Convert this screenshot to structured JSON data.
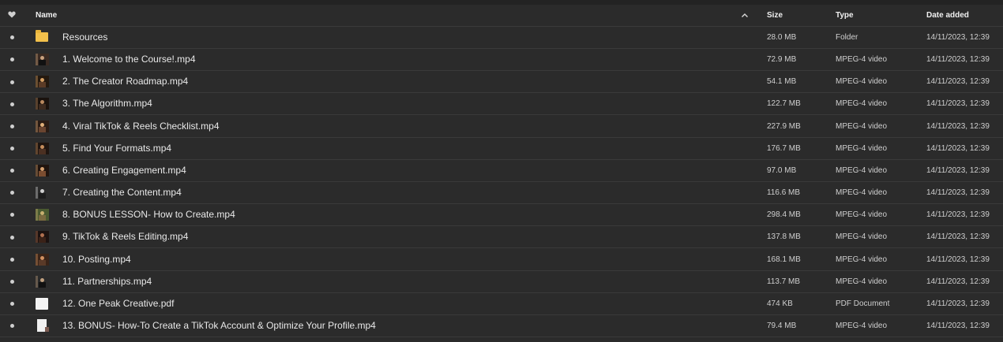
{
  "header": {
    "name": "Name",
    "size": "Size",
    "type": "Type",
    "date": "Date added"
  },
  "rows": [
    {
      "name": "Resources",
      "size": "28.0 MB",
      "type": "Folder",
      "date": "14/11/2023, 12:39",
      "icon": "folder-icon"
    },
    {
      "name": "1. Welcome to the Course!.mp4",
      "size": "72.9 MB",
      "type": "MPEG-4 video",
      "date": "14/11/2023, 12:39",
      "icon": "video-thumbnail-icon"
    },
    {
      "name": "2. The Creator Roadmap.mp4",
      "size": "54.1 MB",
      "type": "MPEG-4 video",
      "date": "14/11/2023, 12:39",
      "icon": "video-thumbnail-icon"
    },
    {
      "name": "3. The Algorithm.mp4",
      "size": "122.7 MB",
      "type": "MPEG-4 video",
      "date": "14/11/2023, 12:39",
      "icon": "video-thumbnail-icon"
    },
    {
      "name": "4. Viral TikTok & Reels Checklist.mp4",
      "size": "227.9 MB",
      "type": "MPEG-4 video",
      "date": "14/11/2023, 12:39",
      "icon": "video-thumbnail-icon"
    },
    {
      "name": "5. Find Your Formats.mp4",
      "size": "176.7 MB",
      "type": "MPEG-4 video",
      "date": "14/11/2023, 12:39",
      "icon": "video-thumbnail-icon"
    },
    {
      "name": "6. Creating Engagement.mp4",
      "size": "97.0 MB",
      "type": "MPEG-4 video",
      "date": "14/11/2023, 12:39",
      "icon": "video-thumbnail-icon"
    },
    {
      "name": "7. Creating the Content.mp4",
      "size": "116.6 MB",
      "type": "MPEG-4 video",
      "date": "14/11/2023, 12:39",
      "icon": "video-thumbnail-icon"
    },
    {
      "name": "8. BONUS LESSON- How to Create.mp4",
      "size": "298.4 MB",
      "type": "MPEG-4 video",
      "date": "14/11/2023, 12:39",
      "icon": "video-thumbnail-icon"
    },
    {
      "name": "9. TikTok & Reels Editing.mp4",
      "size": "137.8 MB",
      "type": "MPEG-4 video",
      "date": "14/11/2023, 12:39",
      "icon": "video-thumbnail-icon"
    },
    {
      "name": "10. Posting.mp4",
      "size": "168.1 MB",
      "type": "MPEG-4 video",
      "date": "14/11/2023, 12:39",
      "icon": "video-thumbnail-icon"
    },
    {
      "name": "11. Partnerships.mp4",
      "size": "113.7 MB",
      "type": "MPEG-4 video",
      "date": "14/11/2023, 12:39",
      "icon": "video-thumbnail-icon"
    },
    {
      "name": "12. One Peak Creative.pdf",
      "size": "474 KB",
      "type": "PDF Document",
      "date": "14/11/2023, 12:39",
      "icon": "pdf-document-icon"
    },
    {
      "name": "13. BONUS- How-To Create a TikTok Account & Optimize Your Profile.mp4",
      "size": "79.4 MB",
      "type": "MPEG-4 video",
      "date": "14/11/2023, 12:39",
      "icon": "video-thumbnail-icon"
    }
  ],
  "colors": {
    "background": "#2b2b2b",
    "divider": "#3a3a3a",
    "text": "#e8e8e8",
    "folder": "#f2c04b"
  }
}
